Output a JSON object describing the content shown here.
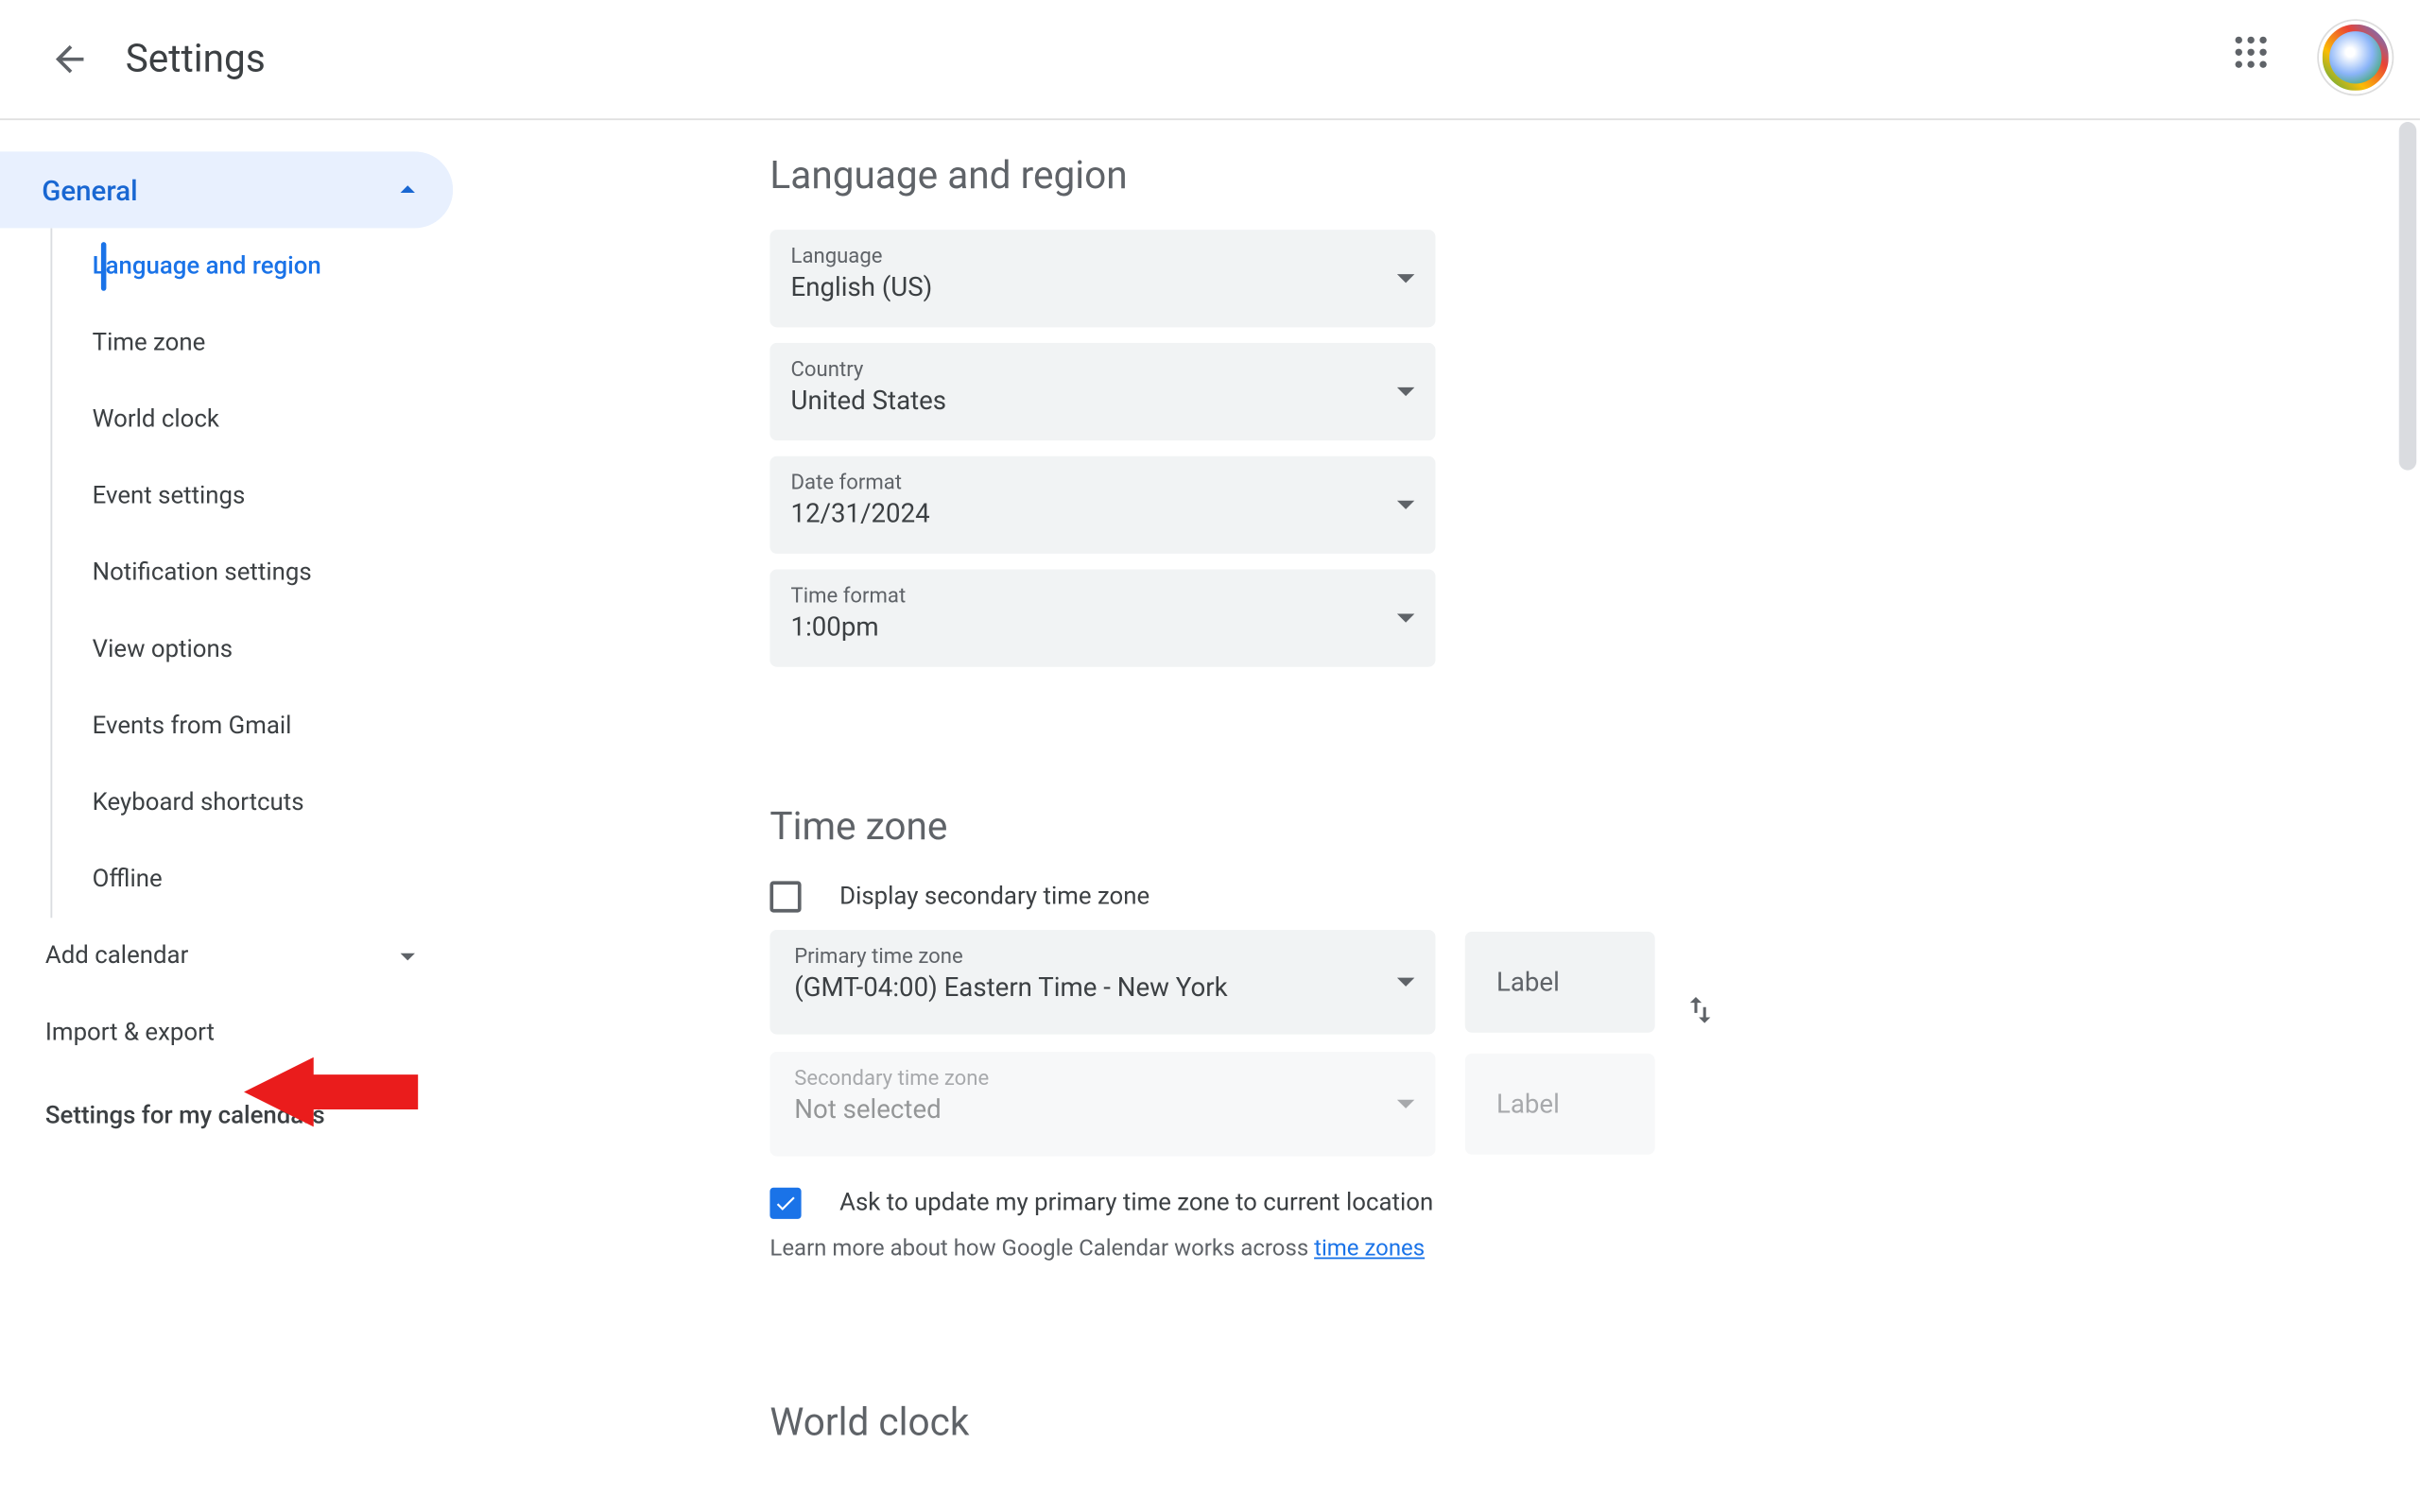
{
  "header": {
    "title": "Settings"
  },
  "sidebar": {
    "general": "General",
    "items": [
      "Language and region",
      "Time zone",
      "World clock",
      "Event settings",
      "Notification settings",
      "View options",
      "Events from Gmail",
      "Keyboard shortcuts",
      "Offline"
    ],
    "addCalendar": "Add calendar",
    "importExport": "Import & export",
    "myCalendars": "Settings for my calendars"
  },
  "content": {
    "langRegion": {
      "title": "Language and region",
      "language": {
        "label": "Language",
        "value": "English (US)"
      },
      "country": {
        "label": "Country",
        "value": "United States"
      },
      "dateFormat": {
        "label": "Date format",
        "value": "12/31/2024"
      },
      "timeFormat": {
        "label": "Time format",
        "value": "1:00pm"
      }
    },
    "timezone": {
      "title": "Time zone",
      "secondary": "Display secondary time zone",
      "primary": {
        "label": "Primary time zone",
        "value": "(GMT-04:00) Eastern Time - New York"
      },
      "secondaryTz": {
        "label": "Secondary time zone",
        "value": "Not selected"
      },
      "labelPlaceholder": "Label",
      "askUpdate": "Ask to update my primary time zone to current location",
      "learn": "Learn more about how Google Calendar works across ",
      "learnLink": "time zones"
    },
    "worldClock": {
      "title": "World clock"
    }
  }
}
